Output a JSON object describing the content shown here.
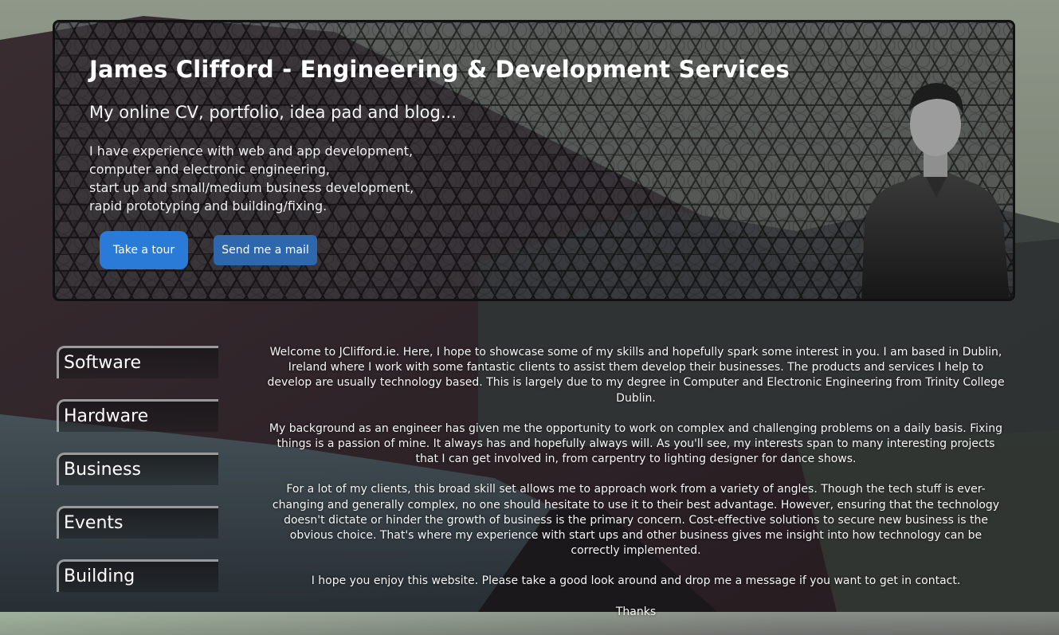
{
  "hero": {
    "title": "James Clifford - Engineering & Development Services",
    "subtitle": "My online CV, portfolio, idea pad and blog...",
    "lines": [
      "I have experience with web and app development,",
      "computer and electronic engineering,",
      "start up and small/medium business development,",
      "rapid prototyping and building/fixing."
    ],
    "tour_button": "Take a tour",
    "mail_button": "Send me a mail"
  },
  "nav": {
    "items": [
      "Software",
      "Hardware",
      "Business",
      "Events",
      "Building"
    ]
  },
  "content": {
    "paragraphs": [
      "Welcome to JClifford.ie. Here, I hope to showcase some of my skills and hopefully spark some interest in you. I am based in Dublin, Ireland where I work with some fantastic clients to assist them develop their businesses. The products and services I help to develop are usually technology based. This is largely due to my degree in Computer and Electronic Engineering from Trinity College Dublin.",
      "My background as an engineer has given me the opportunity to work on complex and challenging problems on a daily basis. Fixing things is a passion of mine. It always has and hopefully always will. As you'll see, my interests span to many interesting projects that I can get involved in, from carpentry to lighting designer for dance shows.",
      "For a lot of my clients, this broad skill set allows me to approach work from a variety of angles. Though the tech stuff is ever-changing and generally complex, no one should hesitate to use it to their best advantage. However, ensuring that the technology doesn't dictate or hinder the growth of business is the primary concern. Cost-effective solutions to secure new business is the obvious choice. That's where my experience with start ups and other business gives me insight into how technology can be correctly implemented.",
      "I hope you enjoy this website. Please take a good look around and drop me a message if you want to get in contact.",
      "Thanks"
    ]
  },
  "colors": {
    "tour_button": "#2a7ad8",
    "mail_button": "#2f67ad",
    "nav_border": "#9a9a9a"
  }
}
